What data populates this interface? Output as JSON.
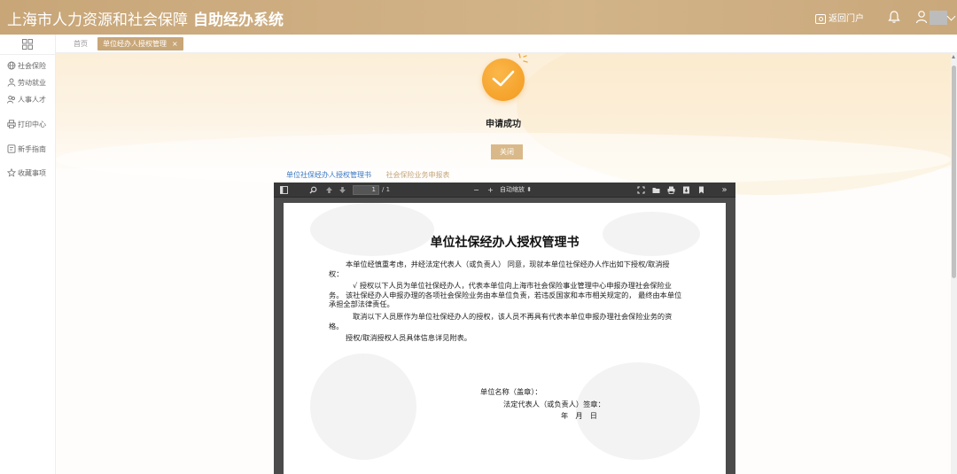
{
  "header": {
    "title": "上海市人力资源和社会保障",
    "subtitle": "自助经办系统",
    "portal_label": "返回门户"
  },
  "sidebar": {
    "items": [
      {
        "label": "社会保险",
        "icon": "globe-icon"
      },
      {
        "label": "劳动就业",
        "icon": "person-icon"
      },
      {
        "label": "人事人才",
        "icon": "people-icon"
      },
      {
        "label": "打印中心",
        "icon": "printer-icon"
      },
      {
        "label": "新手指南",
        "icon": "guide-icon"
      },
      {
        "label": "收藏事项",
        "icon": "star-icon"
      }
    ]
  },
  "tabs": {
    "home": "首页",
    "active": "单位经办人授权管理",
    "close": "×"
  },
  "result": {
    "message": "申请成功",
    "close_button": "关闭"
  },
  "doc_tabs": [
    "单位社保经办人授权管理书",
    "社会保险业务申报表"
  ],
  "pdf": {
    "page_current": "1",
    "page_total": "/ 1",
    "zoom": "自动缩放",
    "zoom_out": "−",
    "zoom_in": "+",
    "more": "»",
    "title": "单位社保经办人授权管理书",
    "para1": "本单位经慎重考虑，并经法定代表人（或负责人） 同意，现就本单位社保经办人作出如下授权/取消授权：",
    "para2": "√ 授权以下人员为单位社保经办人，代表本单位向上海市社会保险事业管理中心申报办理社会保险业务。 该社保经办人申报办理的各项社会保险业务由本单位负责，若违反国家和本市相关规定的， 最终由本单位承担全部法律责任。",
    "para3": "取消以下人员原作为单位社保经办人的授权，该人员不再具有代表本单位申报办理社会保险业务的资格。",
    "para4": "授权/取消授权人员具体信息详见附表。",
    "sign_unit": "单位名称（盖章）：",
    "sign_rep": "法定代表人（或负责人）签章：",
    "sign_date": "年　月　日"
  },
  "colors": {
    "header": "#c8a678",
    "accent": "#f29a1e",
    "link": "#3a78c3"
  }
}
